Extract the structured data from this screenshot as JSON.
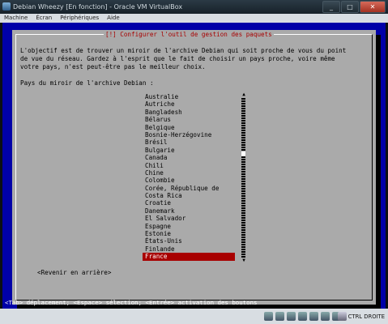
{
  "window": {
    "title": "Debian Wheezy [En fonction] - Oracle VM VirtualBox",
    "buttons": [
      "_",
      "□",
      "✕"
    ]
  },
  "menubar": [
    "Machine",
    "Écran",
    "Périphériques",
    "Aide"
  ],
  "dialog": {
    "title": "[!] Configurer l'outil de gestion des paquets",
    "description": "L'objectif est de trouver un miroir de l'archive Debian qui soit proche de vous du point\nde vue du réseau. Gardez à l'esprit que le fait de choisir un pays proche, voire même\nvotre pays, n'est peut-être pas le meilleur choix.",
    "label": "Pays du miroir de l'archive Debian :",
    "countries": [
      "Australie",
      "Autriche",
      "Bangladesh",
      "Bélarus",
      "Belgique",
      "Bosnie-Herzégovine",
      "Brésil",
      "Bulgarie",
      "Canada",
      "Chili",
      "Chine",
      "Colombie",
      "Corée, République de",
      "Costa Rica",
      "Croatie",
      "Danemark",
      "El Salvador",
      "Espagne",
      "Estonie",
      "États-Unis",
      "Finlande",
      "France"
    ],
    "selected": "France",
    "back_button": "<Revenir en arrière>"
  },
  "hint": "<Tab> déplacement; <Espace> sélection; <Entrée> activation des boutons",
  "statusbar": {
    "host_key": "CTRL DROITE",
    "icons": [
      "hdd-icon",
      "cd-icon",
      "usb-icon",
      "network-icon",
      "shared-folder-icon",
      "display-icon",
      "capture-icon"
    ]
  }
}
